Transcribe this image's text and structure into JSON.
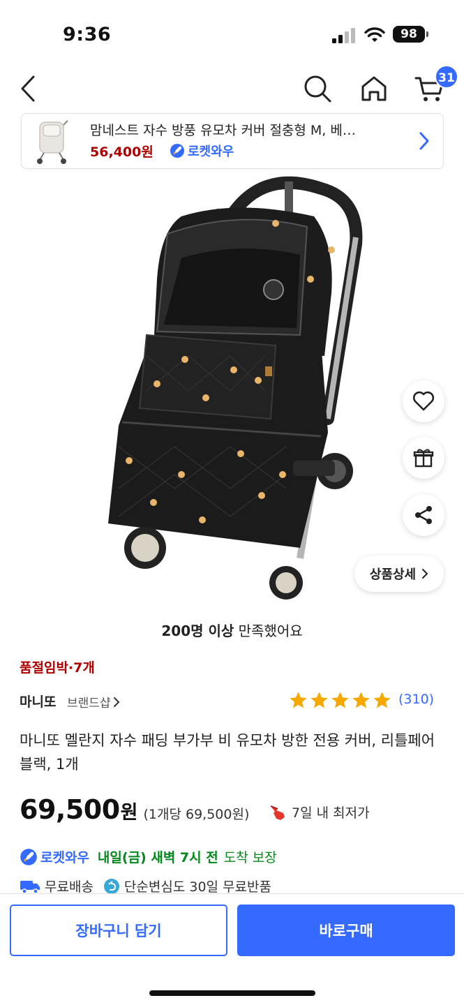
{
  "status_bar": {
    "time": "9:36",
    "battery": "98"
  },
  "nav": {
    "cart_count": "31"
  },
  "related_product": {
    "title": "맘네스트 자수 방풍 유모차 커버 절충형 M, 베…",
    "price": "56,400원",
    "badge": "로켓와우"
  },
  "side_actions": {
    "detail_label": "상품상세"
  },
  "satisfaction": {
    "bold": "200명 이상",
    "rest": " 만족했어요"
  },
  "stock_notice": "품절임박·7개",
  "brand": {
    "name": "마니또",
    "shop_label": "브랜드샵"
  },
  "rating": {
    "stars": 5,
    "count": "(310)"
  },
  "product_title": "마니또 멜란지 자수 패딩 부가부 비 유모차 방한 전용 커버, 리틀페어 블랙, 1개",
  "price": {
    "amount": "69,500",
    "currency": "원",
    "unit_price": "(1개당 69,500원)",
    "lowest_label": "7일 내 최저가"
  },
  "delivery": {
    "badge": "로켓와우",
    "date": "내일(금) 새벽 7시 전",
    "guarantee": "도착 보장"
  },
  "shipping": {
    "free_shipping": "무료배송",
    "free_return": "단순변심도 30일 무료반품"
  },
  "bottom_bar": {
    "cart_button": "장바구니 담기",
    "buy_button": "바로구매"
  },
  "colors": {
    "accent": "#346aff",
    "price_red": "#ae0000",
    "delivery_green": "#00891a",
    "star": "#f5a900"
  }
}
